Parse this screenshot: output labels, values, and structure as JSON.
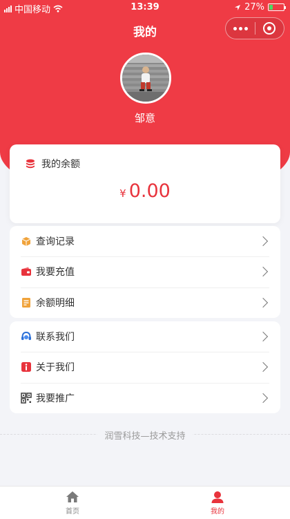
{
  "status_bar": {
    "carrier": "中国移动",
    "time": "13:39",
    "battery": "27%",
    "battery_level": 0.27
  },
  "nav": {
    "title": "我的"
  },
  "profile": {
    "username": "邹意"
  },
  "balance": {
    "label": "我的余额",
    "currency": "¥",
    "amount": "0.00"
  },
  "menu_group_1": [
    {
      "label": "查询记录",
      "icon": "box-icon"
    },
    {
      "label": "我要充值",
      "icon": "wallet-icon"
    },
    {
      "label": "余额明细",
      "icon": "receipt-icon"
    }
  ],
  "menu_group_2": [
    {
      "label": "联系我们",
      "icon": "headset-icon"
    },
    {
      "label": "关于我们",
      "icon": "info-icon"
    },
    {
      "label": "我要推广",
      "icon": "qrcode-icon"
    }
  ],
  "footer": {
    "text": "润雪科技—技术支持"
  },
  "tabs": [
    {
      "label": "首页",
      "icon": "home-icon"
    },
    {
      "label": "我的",
      "icon": "user-icon"
    }
  ],
  "colors": {
    "brand_red": "#ef3b45",
    "amount_red": "#e8333c",
    "background": "#f3f4f8"
  }
}
